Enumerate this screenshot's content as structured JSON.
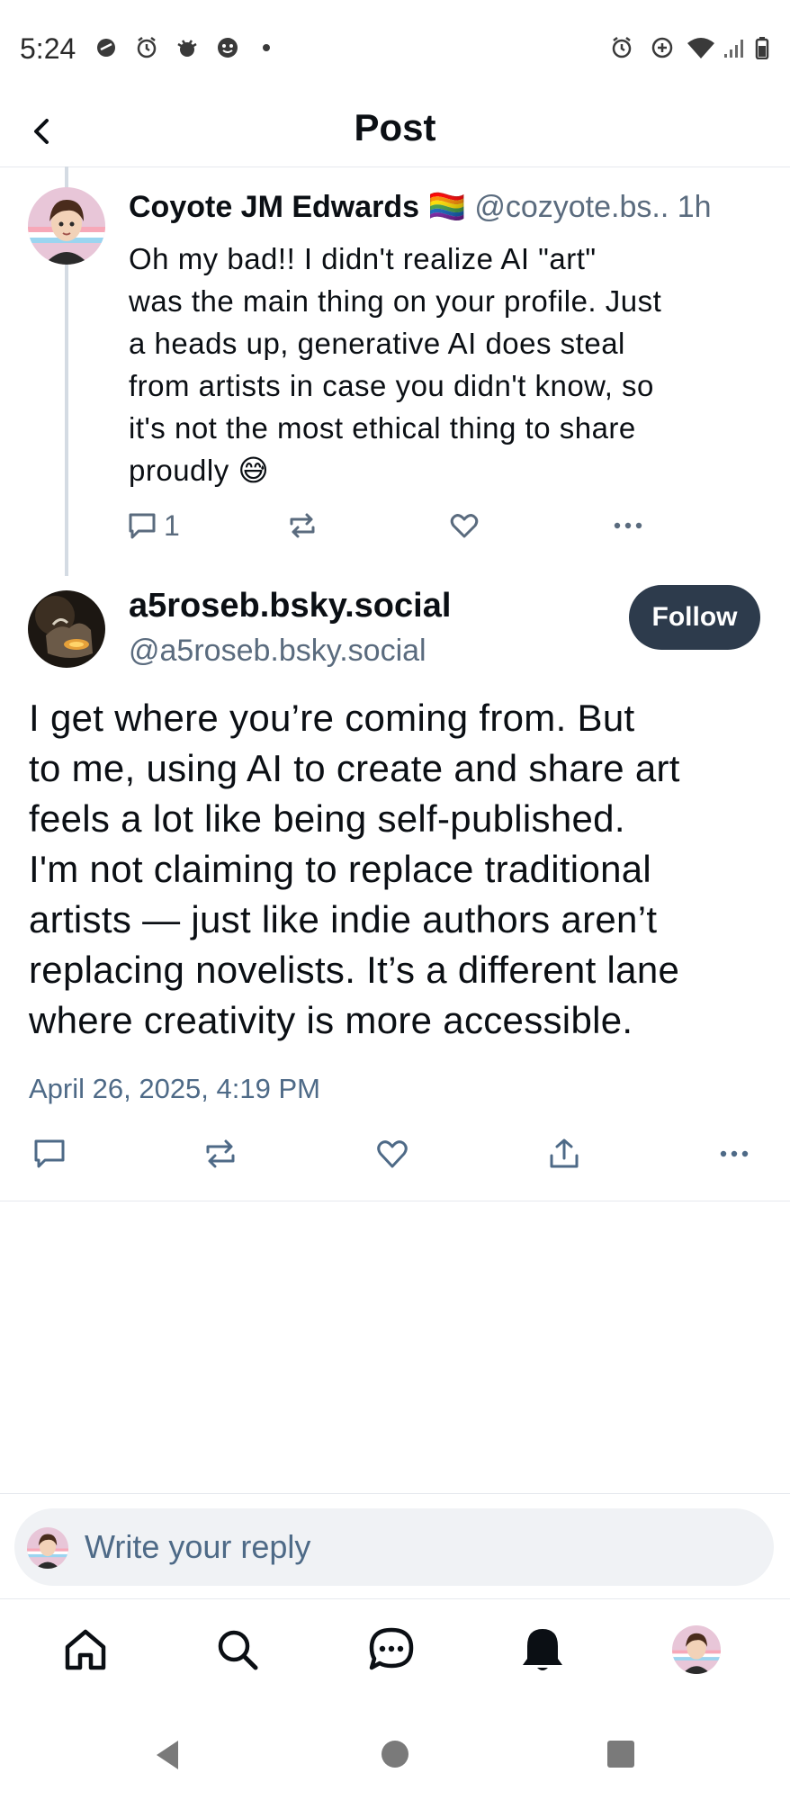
{
  "status_bar": {
    "time": "5:24"
  },
  "header": {
    "title": "Post"
  },
  "parent_post": {
    "author_name": "Coyote JM Edwards",
    "flag": "🏳️‍🌈",
    "handle": "@cozyote.bs..",
    "time_ago": "1h",
    "text_lines": [
      "Oh my bad!! I didn't realize AI \"art\"",
      "was the main thing on your profile. Just",
      "a heads up, generative AI does steal",
      "from artists in case you didn't know, so",
      "it's not the most ethical thing to share",
      "proudly 😅"
    ],
    "reply_count": "1",
    "actions": [
      "reply-icon",
      "repost-icon",
      "like-icon",
      "more-icon"
    ]
  },
  "main_post": {
    "author_name": "a5roseb.bsky.social",
    "handle": "@a5roseb.bsky.social",
    "follow_label": "Follow",
    "text_lines": [
      "I get where you’re coming from. But",
      "to me, using AI to create and share art",
      "feels a lot like being self-published.",
      "I'm not claiming to replace traditional",
      "artists — just like indie authors aren’t",
      "replacing novelists. It’s a different lane",
      "where creativity is more accessible."
    ],
    "date": "April 26, 2025, 4:19 PM",
    "actions": [
      "reply-icon",
      "repost-icon",
      "like-icon",
      "share-icon",
      "more-icon"
    ]
  },
  "composer": {
    "placeholder": "Write your reply"
  },
  "bottom_nav": {
    "items": [
      "home-icon",
      "search-icon",
      "chat-icon",
      "notifications-icon",
      "profile-avatar"
    ]
  },
  "colors": {
    "accent_dark": "#2d3b4c",
    "muted_text": "#5a6b7e",
    "link_muted": "#4e6a87",
    "divider": "#e6e9ee"
  }
}
